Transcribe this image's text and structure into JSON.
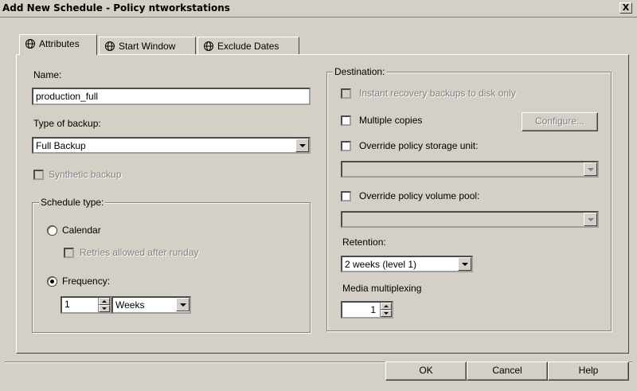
{
  "window": {
    "title": "Add New Schedule - Policy ntworkstations",
    "close_glyph": "X"
  },
  "tabs": [
    {
      "label": "Attributes",
      "icon": "gear-globe-icon"
    },
    {
      "label": "Start Window",
      "icon": "gear-globe-icon"
    },
    {
      "label": "Exclude Dates",
      "icon": "gear-globe-icon"
    }
  ],
  "left": {
    "name_label": "Name:",
    "name_value": "production_full",
    "type_label": "Type of backup:",
    "type_value": "Full Backup",
    "synthetic_label": "Synthetic backup",
    "schedule_type": {
      "title": "Schedule type:",
      "calendar_label": "Calendar",
      "retries_label": "Retries allowed after runday",
      "frequency_label": "Frequency:",
      "frequency_value": "1",
      "frequency_unit": "Weeks"
    }
  },
  "right": {
    "destination_title": "Destination:",
    "instant_recovery_label": "Instant recovery backups to disk only",
    "multiple_copies_label": "Multiple copies",
    "configure_label": "Configure...",
    "override_storage_label": "Override policy storage unit:",
    "storage_value": "",
    "override_pool_label": "Override policy volume pool:",
    "pool_value": "",
    "retention_label": "Retention:",
    "retention_value": "2 weeks (level 1)",
    "multiplexing_label": "Media multiplexing",
    "multiplexing_value": "1"
  },
  "footer": {
    "ok_label": "OK",
    "cancel_label": "Cancel",
    "help_label": "Help"
  }
}
